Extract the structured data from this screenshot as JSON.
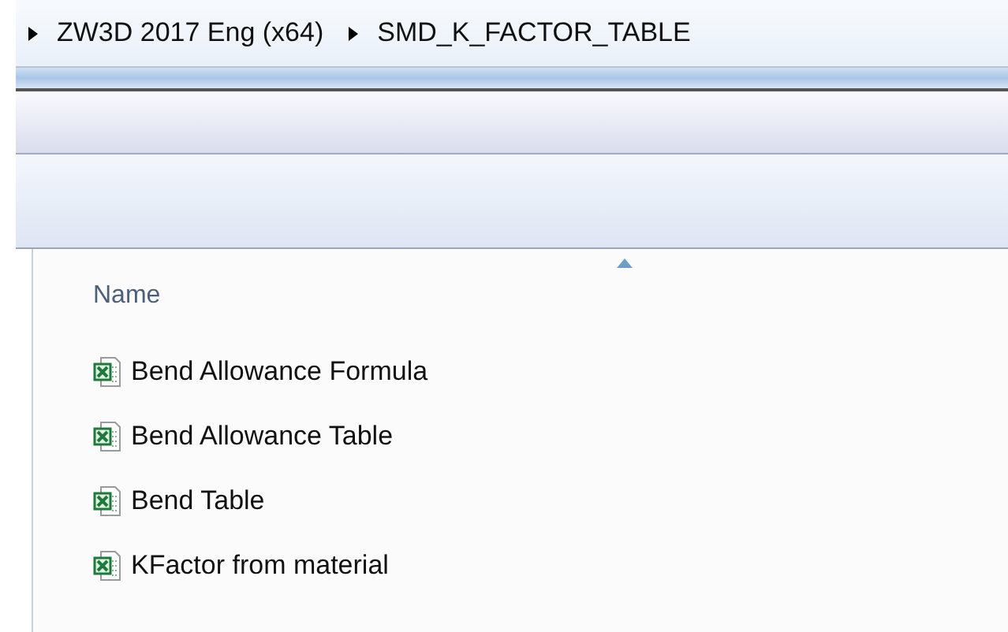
{
  "breadcrumb": [
    "ZW3D 2017 Eng (x64)",
    "SMD_K_FACTOR_TABLE"
  ],
  "column": {
    "label": "Name",
    "sorted": true
  },
  "files": [
    {
      "name": "Bend Allowance Formula"
    },
    {
      "name": "Bend Allowance Table"
    },
    {
      "name": "Bend Table"
    },
    {
      "name": "KFactor from material"
    }
  ]
}
